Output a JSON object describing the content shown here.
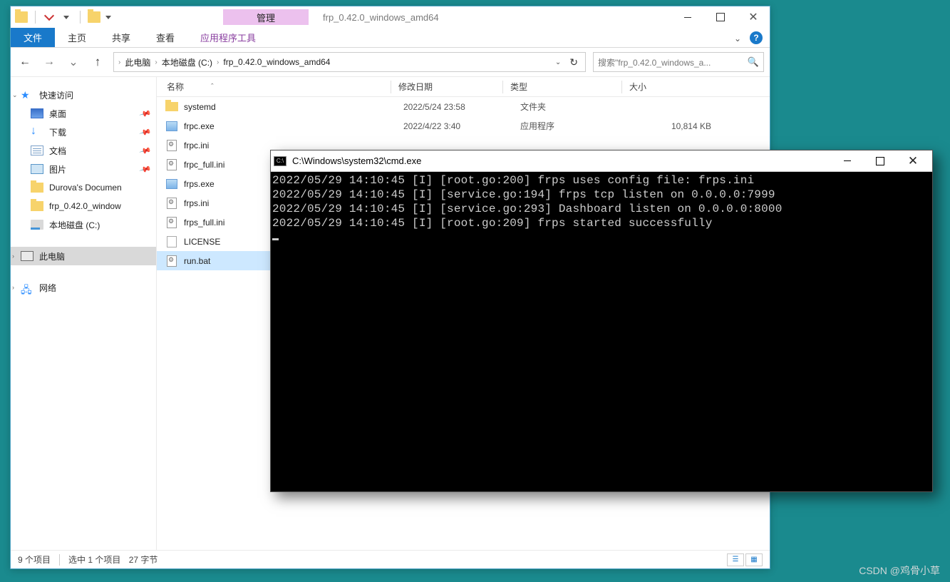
{
  "explorer": {
    "manage_tab": "管理",
    "title": "frp_0.42.0_windows_amd64",
    "ribbon": {
      "file": "文件",
      "home": "主页",
      "share": "共享",
      "view": "查看",
      "tools": "应用程序工具"
    },
    "breadcrumbs": [
      "此电脑",
      "本地磁盘 (C:)",
      "frp_0.42.0_windows_amd64"
    ],
    "search_placeholder": "搜索\"frp_0.42.0_windows_a...",
    "columns": {
      "name": "名称",
      "date": "修改日期",
      "type": "类型",
      "size": "大小"
    },
    "nav": {
      "quick": "快速访问",
      "desktop": "桌面",
      "downloads": "下载",
      "documents": "文档",
      "pictures": "图片",
      "durova": "Durova's Documen",
      "frpfolder": "frp_0.42.0_window",
      "cdrive": "本地磁盘 (C:)",
      "thispc": "此电脑",
      "network": "网络"
    },
    "files": [
      {
        "icon": "folder",
        "name": "systemd",
        "date": "2022/5/24 23:58",
        "type": "文件夹",
        "size": ""
      },
      {
        "icon": "exe",
        "name": "frpc.exe",
        "date": "2022/4/22 3:40",
        "type": "应用程序",
        "size": "10,814 KB"
      },
      {
        "icon": "ini",
        "name": "frpc.ini",
        "date": "",
        "type": "",
        "size": ""
      },
      {
        "icon": "ini",
        "name": "frpc_full.ini",
        "date": "",
        "type": "",
        "size": ""
      },
      {
        "icon": "exe",
        "name": "frps.exe",
        "date": "",
        "type": "",
        "size": ""
      },
      {
        "icon": "ini",
        "name": "frps.ini",
        "date": "",
        "type": "",
        "size": ""
      },
      {
        "icon": "ini",
        "name": "frps_full.ini",
        "date": "",
        "type": "",
        "size": ""
      },
      {
        "icon": "txt",
        "name": "LICENSE",
        "date": "",
        "type": "",
        "size": ""
      },
      {
        "icon": "bat",
        "name": "run.bat",
        "date": "",
        "type": "",
        "size": "",
        "selected": true
      }
    ],
    "status": {
      "items": "9 个项目",
      "selected": "选中 1 个项目",
      "bytes": "27 字节"
    }
  },
  "cmd": {
    "title": "C:\\Windows\\system32\\cmd.exe",
    "lines": [
      "2022/05/29 14:10:45 [I] [root.go:200] frps uses config file: frps.ini",
      "2022/05/29 14:10:45 [I] [service.go:194] frps tcp listen on 0.0.0.0:7999",
      "2022/05/29 14:10:45 [I] [service.go:293] Dashboard listen on 0.0.0.0:8000",
      "2022/05/29 14:10:45 [I] [root.go:209] frps started successfully"
    ]
  },
  "watermark": "CSDN @鸡骨小草"
}
